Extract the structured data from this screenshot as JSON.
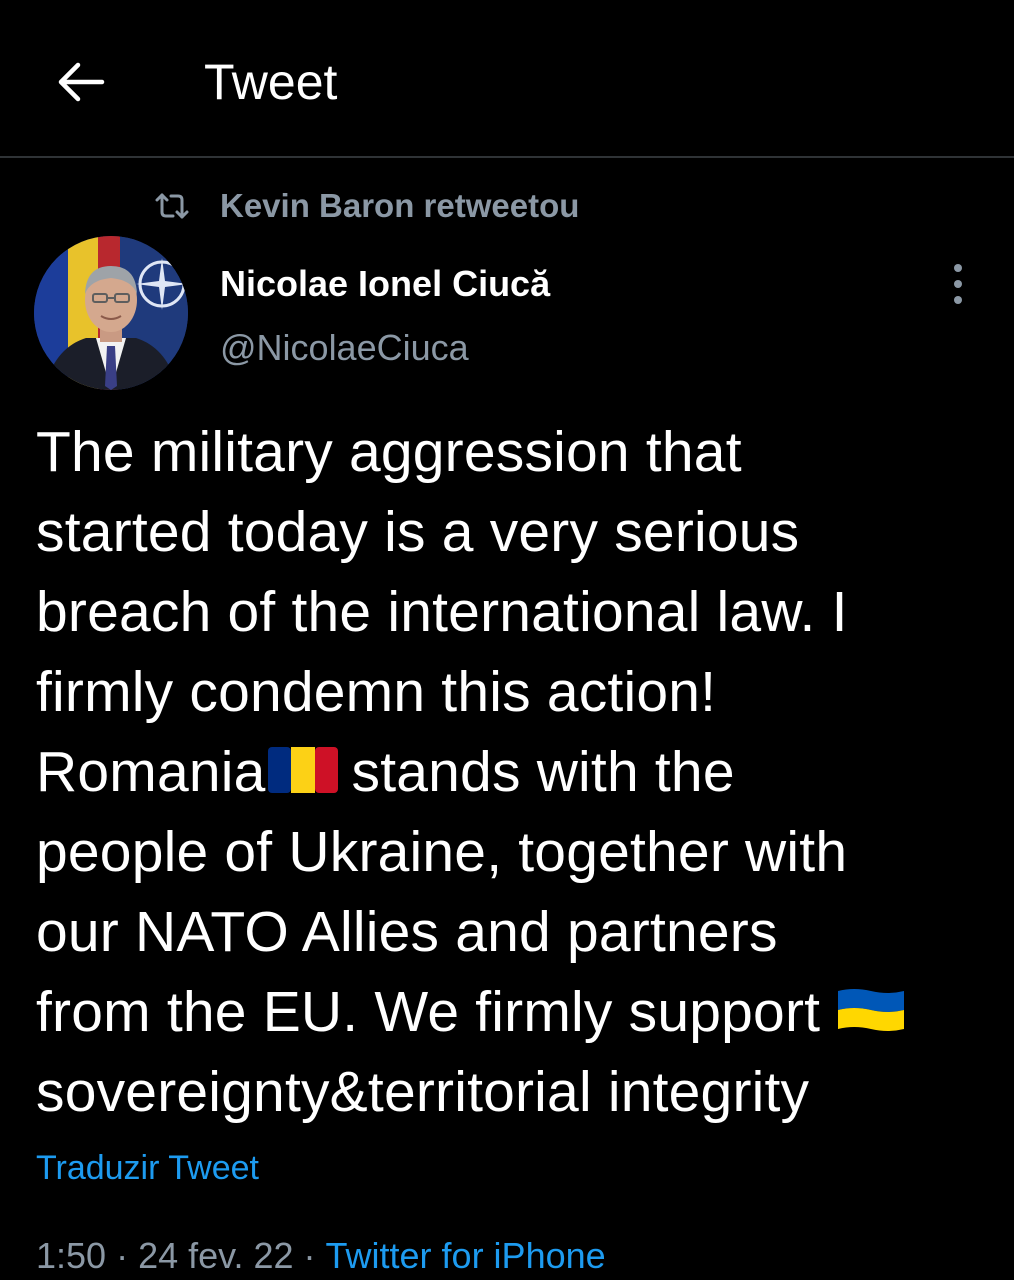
{
  "header": {
    "title": "Tweet",
    "back_icon": "arrow-left-icon"
  },
  "retweet": {
    "icon": "retweet-icon",
    "text": "Kevin Baron retweetou"
  },
  "author": {
    "display_name": "Nicolae Ionel Ciucă",
    "handle": "@NicolaeCiuca",
    "avatar": "profile-photo"
  },
  "tweet": {
    "lines": [
      "The military aggression that",
      "started today is a very serious",
      "breach of the international law. I",
      "firmly condemn this action!",
      "Romania",
      "stands with the",
      "people of Ukraine, together with",
      "our NATO Allies and partners",
      "from the EU. We firmly support",
      "sovereignty&territorial integrity"
    ],
    "flags": {
      "romania": [
        "#002b7f",
        "#fcd116",
        "#ce1126"
      ],
      "ukraine": [
        "#0057b7",
        "#ffd700"
      ]
    }
  },
  "translate_label": "Traduzir Tweet",
  "meta": {
    "time": "1:50",
    "date": "24 fev. 22",
    "separator": "·",
    "source": "Twitter for iPhone"
  },
  "colors": {
    "background": "#000000",
    "text": "#ffffff",
    "secondary": "#8b98a5",
    "link": "#1d9bf0",
    "divider": "#2f3336"
  }
}
